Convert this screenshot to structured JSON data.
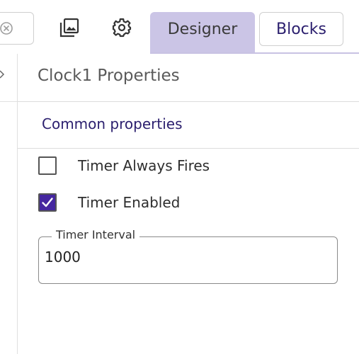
{
  "toolbar": {
    "clear_icon": "clear-circle-x-icon",
    "gallery_icon": "image-gallery-icon",
    "settings_icon": "gear-icon",
    "tabs": [
      {
        "label": "Designer",
        "active": true
      },
      {
        "label": "Blocks",
        "active": false
      }
    ]
  },
  "properties": {
    "title": "Clock1 Properties",
    "section": "Common properties",
    "timer_always_fires": {
      "label": "Timer Always Fires",
      "checked": false
    },
    "timer_enabled": {
      "label": "Timer Enabled",
      "checked": true
    },
    "timer_interval": {
      "label": "Timer Interval",
      "value": "1000"
    }
  },
  "colors": {
    "accent": "#4527a0",
    "tab_active_bg": "#cbc5e6",
    "link_text": "#2b1f6e"
  }
}
